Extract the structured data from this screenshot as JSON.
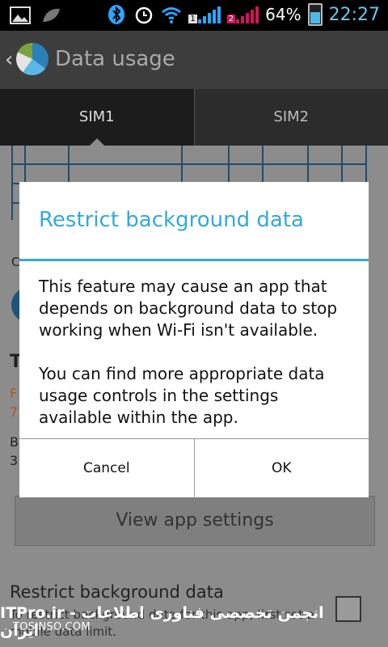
{
  "status_bar": {
    "battery": "64%",
    "time": "22:27",
    "sim1_number": "1",
    "sim2_number": "2"
  },
  "action_bar": {
    "title": "Data usage"
  },
  "tabs": [
    {
      "label": "SIM1"
    },
    {
      "label": "SIM2"
    }
  ],
  "background": {
    "restrict_title": "Restrict background data",
    "restrict_desc": "To restrict background data for this app, first set a mobile data limit.",
    "view_app_settings": "View app settings",
    "partial_texts": [
      "C",
      "T",
      "F",
      "7",
      "B",
      "3"
    ]
  },
  "watermark": {
    "site": "TOSINSO.COM",
    "brand": "ITPro.ir - انجمن تخصصی فناوری اطلاعات ایران"
  },
  "dialog": {
    "title": "Restrict background data",
    "message1": "This feature may cause an app that depends on background data to stop working when Wi-Fi isn't available.",
    "message2": "You can find more appropriate data usage controls in the settings available within the app.",
    "cancel": "Cancel",
    "ok": "OK"
  }
}
